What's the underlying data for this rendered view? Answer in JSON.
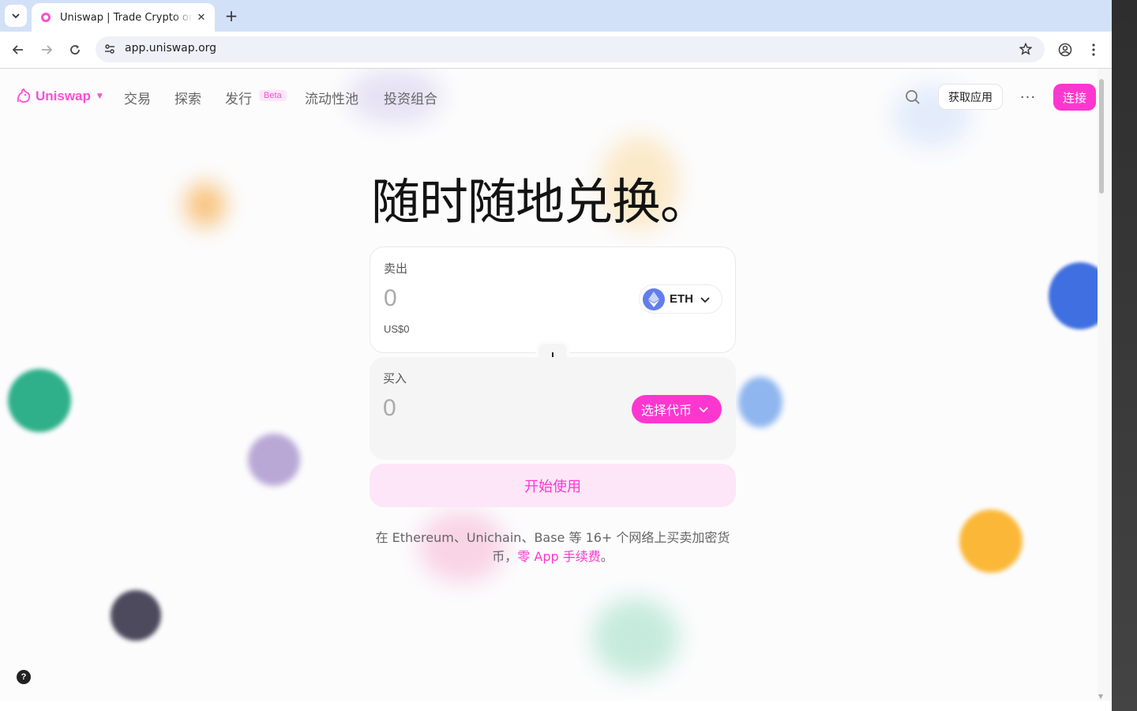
{
  "browser": {
    "tab_title": "Uniswap | Trade Crypto on DeFi's Leading Exchange",
    "url": "app.uniswap.org",
    "close_glyph": "✕",
    "new_tab_glyph": "+"
  },
  "nav": {
    "logo": "Uniswap",
    "items": [
      "交易",
      "探索",
      "发行",
      "流动性池",
      "投资组合"
    ],
    "beta_badge": "Beta",
    "get_app": "获取应用",
    "more": "···",
    "connect": "连接"
  },
  "hero": {
    "title": "随时随地兑换。"
  },
  "sell": {
    "label": "卖出",
    "amount": "0",
    "usd": "US$0",
    "token": "ETH"
  },
  "buy": {
    "label": "买入",
    "amount": "0",
    "select_token": "选择代币"
  },
  "start_button": "开始使用",
  "description": {
    "text": "在 Ethereum、Unichain、Base 等 16+ 个网络上买卖加密货币，",
    "link": "零 App 手续费",
    "end": "。"
  },
  "help": "?",
  "colors": {
    "accent": "#fc37d0",
    "brand": "#fc4fd3",
    "eth": "#627eea"
  }
}
